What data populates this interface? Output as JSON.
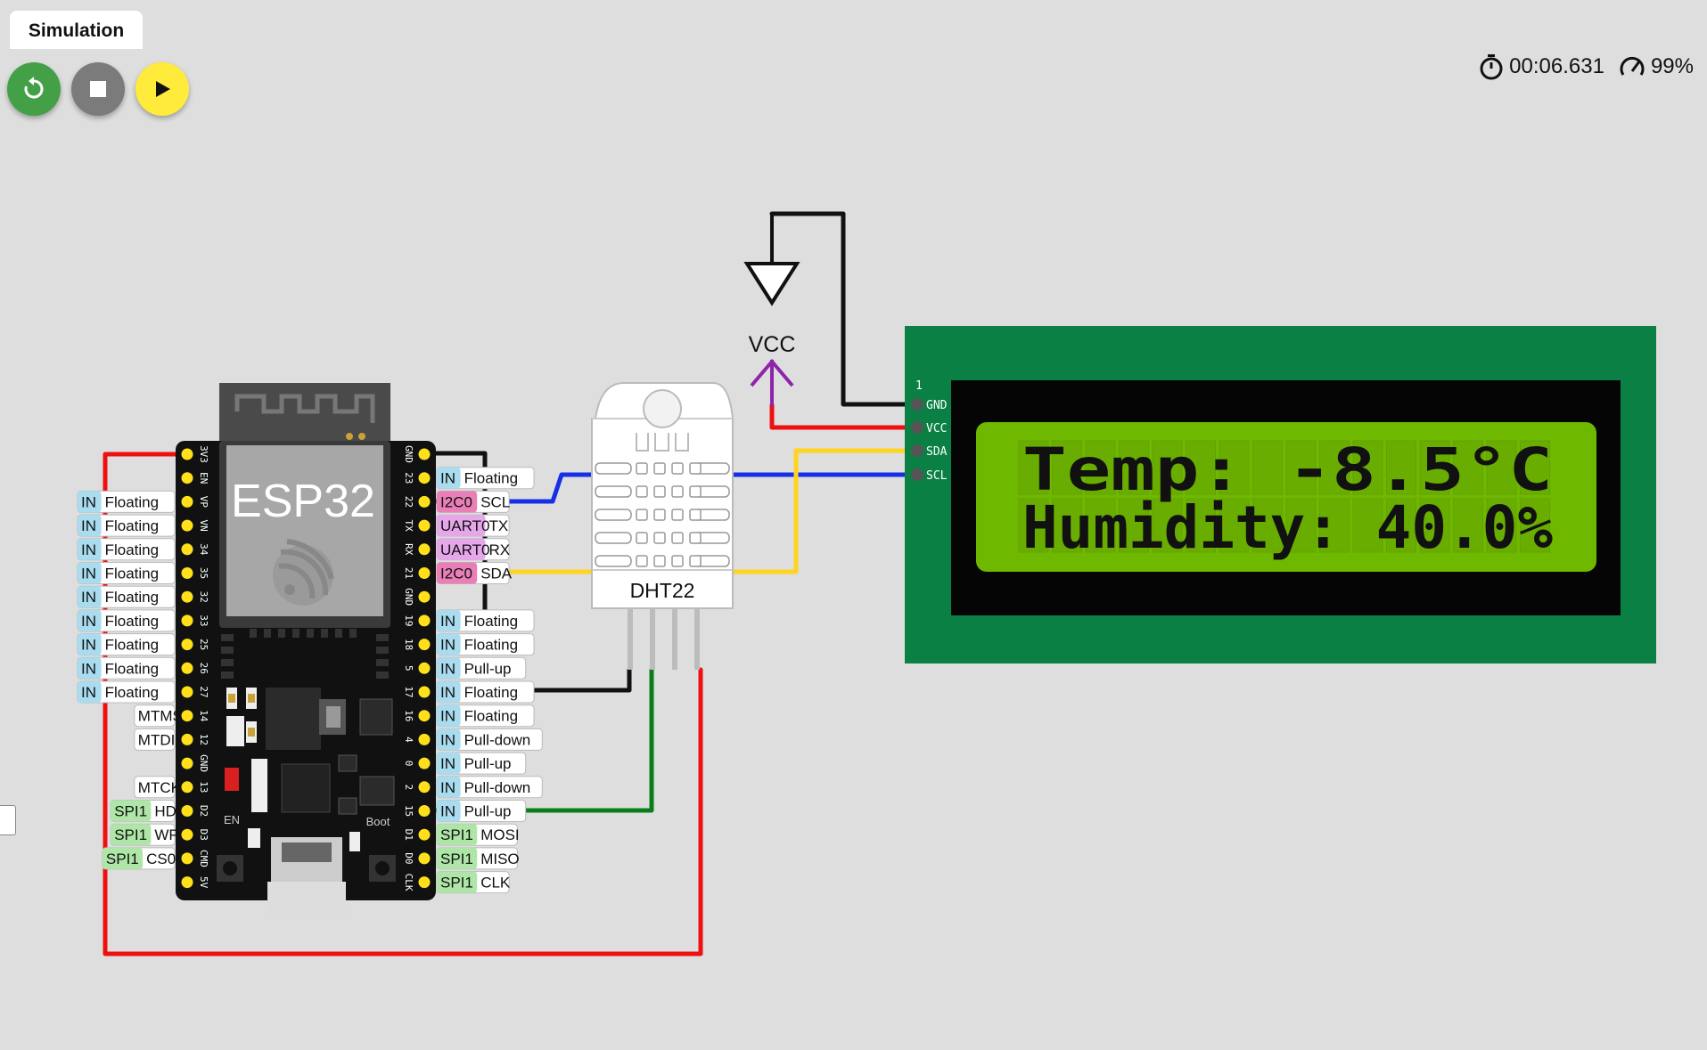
{
  "tab": {
    "label": "Simulation"
  },
  "controls": {
    "restart_icon": "restart-icon",
    "stop_icon": "stop-icon",
    "play_icon": "play-icon",
    "restart_color": "#43a047",
    "stop_color": "#7b7b7b",
    "play_color": "#ffeb3b"
  },
  "status": {
    "timer": "00:06.631",
    "speed": "99%"
  },
  "esp32": {
    "label": "ESP32",
    "left_pins": [
      "3V3",
      "EN",
      "VP",
      "VN",
      "34",
      "35",
      "32",
      "33",
      "25",
      "26",
      "27",
      "14",
      "12",
      "GND",
      "13",
      "D2",
      "D3",
      "CMD",
      "5V"
    ],
    "right_pins": [
      "GND",
      "23",
      "22",
      "TX",
      "RX",
      "21",
      "GND",
      "19",
      "18",
      "5",
      "17",
      "16",
      "4",
      "0",
      "2",
      "15",
      "D1",
      "D0",
      "CLK"
    ],
    "left_labels": [
      {
        "row": 2,
        "tag": "IN",
        "text": "Floating"
      },
      {
        "row": 3,
        "tag": "IN",
        "text": "Floating"
      },
      {
        "row": 4,
        "tag": "IN",
        "text": "Floating"
      },
      {
        "row": 5,
        "tag": "IN",
        "text": "Floating"
      },
      {
        "row": 6,
        "tag": "IN",
        "text": "Floating"
      },
      {
        "row": 7,
        "tag": "IN",
        "text": "Floating"
      },
      {
        "row": 8,
        "tag": "IN",
        "text": "Floating"
      },
      {
        "row": 9,
        "tag": "IN",
        "text": "Floating"
      },
      {
        "row": 10,
        "tag": "IN",
        "text": "Floating"
      },
      {
        "row": 11,
        "tag": "",
        "text": "MTMS"
      },
      {
        "row": 12,
        "tag": "",
        "text": "MTDI"
      },
      {
        "row": 14,
        "tag": "",
        "text": "MTCK"
      },
      {
        "row": 15,
        "tag": "SPI1",
        "text": "HD"
      },
      {
        "row": 16,
        "tag": "SPI1",
        "text": "WP"
      },
      {
        "row": 17,
        "tag": "SPI1",
        "text": "CS0"
      }
    ],
    "right_labels": [
      {
        "row": 1,
        "tag": "IN",
        "text": "Floating"
      },
      {
        "row": 2,
        "tag": "I2C0",
        "text": "SCL"
      },
      {
        "row": 3,
        "tag": "UART0",
        "text": "TX"
      },
      {
        "row": 4,
        "tag": "UART0",
        "text": "RX"
      },
      {
        "row": 5,
        "tag": "I2C0",
        "text": "SDA"
      },
      {
        "row": 7,
        "tag": "IN",
        "text": "Floating"
      },
      {
        "row": 8,
        "tag": "IN",
        "text": "Floating"
      },
      {
        "row": 9,
        "tag": "IN",
        "text": "Pull-up"
      },
      {
        "row": 10,
        "tag": "IN",
        "text": "Floating"
      },
      {
        "row": 11,
        "tag": "IN",
        "text": "Floating"
      },
      {
        "row": 12,
        "tag": "IN",
        "text": "Pull-down"
      },
      {
        "row": 13,
        "tag": "IN",
        "text": "Pull-up"
      },
      {
        "row": 14,
        "tag": "IN",
        "text": "Pull-down"
      },
      {
        "row": 15,
        "tag": "IN",
        "text": "Pull-up"
      },
      {
        "row": 16,
        "tag": "SPI1",
        "text": "MOSI"
      },
      {
        "row": 17,
        "tag": "SPI1",
        "text": "MISO"
      },
      {
        "row": 18,
        "tag": "SPI1",
        "text": "CLK"
      }
    ],
    "button_en": "EN",
    "button_boot": "Boot"
  },
  "tag_colors": {
    "IN": "#a9dcef",
    "I2C0": "#ea7fb7",
    "UART0": "#e6a6ea",
    "SPI1": "#aee6a7"
  },
  "dht22": {
    "label": "DHT22"
  },
  "vcc": {
    "label": "VCC"
  },
  "lcd": {
    "pin_number": "1",
    "pins": [
      "GND",
      "VCC",
      "SDA",
      "SCL"
    ],
    "line1": "Temp: -8.5°C",
    "line2": "Humidity: 40.0%"
  }
}
